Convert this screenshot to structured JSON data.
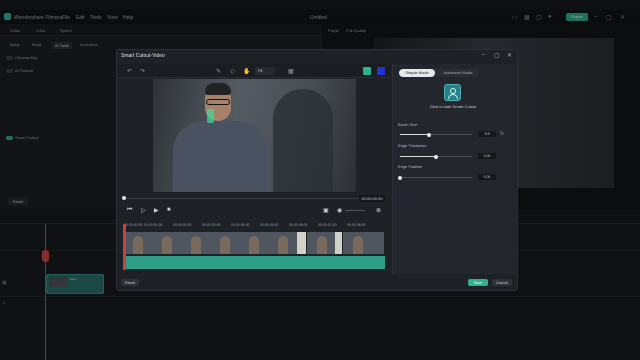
{
  "app": {
    "name": "Wondershare Filmora",
    "menu": [
      "File",
      "Edit",
      "Tools",
      "View",
      "Help"
    ],
    "project_title": "Untitled",
    "export_label": "Export"
  },
  "left_panel": {
    "tabs": [
      "Video",
      "Color",
      "Speed"
    ],
    "subtabs": [
      "Basic",
      "Mask",
      "AI Tools",
      "Animation"
    ],
    "active_subtab": "AI Tools",
    "options": [
      "Chroma Key",
      "AI Portrait",
      "Smart Cutout"
    ],
    "reset_label": "Reset"
  },
  "player": {
    "label": "Player",
    "quality": "Full Quality"
  },
  "dialog": {
    "title": "Smart Cutout-Video",
    "zoom": "Fit",
    "current_time": "00:00:00:00",
    "ruler_times": [
      "00:00:00:00",
      "00:00:01:00",
      "00:00:02:00",
      "00:00:03:00",
      "00:00:04:00",
      "00:00:05:00",
      "00:00:06:00",
      "00:00:07:00",
      "00:00:08:00"
    ],
    "modes": [
      "Simple Mode",
      "Advanced Mode"
    ],
    "active_mode": "Simple Mode",
    "start_text": "Click to start Smart Cutout",
    "brush_size": {
      "label": "Brush Size",
      "value": "110",
      "fraction": 0.4
    },
    "edge_thickness": {
      "label": "Edge Thickness",
      "value": "0.00",
      "fraction": 0.5
    },
    "edge_feather": {
      "label": "Edge Feather",
      "value": "0.00",
      "fraction": 0.0
    },
    "reset_label": "Reset",
    "save_label": "Save",
    "cancel_label": "Cancel"
  },
  "colors": {
    "accent": "#2fb08f",
    "playhead": "#d04848",
    "teal_strip": "#2e9e86"
  }
}
